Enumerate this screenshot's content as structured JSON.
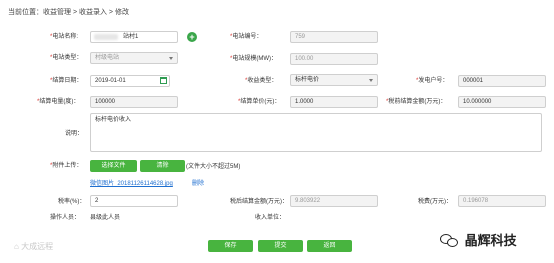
{
  "breadcrumb": "当前位置：收益管理 > 收益录入 > 修改",
  "form": {
    "station_name": {
      "label": "电站名称:",
      "value": "站村1"
    },
    "station_no": {
      "label": "电站编号：",
      "value": "759"
    },
    "station_type": {
      "label": "电站类型：",
      "value": "村级电站"
    },
    "station_scale": {
      "label": "电站规模(MW)：",
      "value": "100.00"
    },
    "settle_date": {
      "label": "结算日期：",
      "value": "2019-01-01"
    },
    "income_type": {
      "label": "收益类型：",
      "value": "标杆电价"
    },
    "account_no": {
      "label": "发电户号：",
      "value": "000001"
    },
    "settle_power": {
      "label": "结算电量(度)：",
      "value": "100000"
    },
    "settle_price": {
      "label": "结算单价(元)：",
      "value": "1.0000"
    },
    "pretax_amount": {
      "label": "税前结算金额(万元)：",
      "value": "10.000000"
    },
    "description": {
      "label": "说明：",
      "value": "标杆电价收入"
    },
    "attachment": {
      "label": "附件上传：",
      "choose_button": "选择文件",
      "clear_button": "清除",
      "hint": "(文件大小不超过5M)",
      "file_name": "微信图片_20181126114628.jpg",
      "delete_link": "删除"
    },
    "tax_rate": {
      "label": "税率(%)：",
      "value": "2"
    },
    "aftertax_amount": {
      "label": "税后结算金额(万元)：",
      "value": "9.803922"
    },
    "tax_amount": {
      "label": "税费(万元)：",
      "value": "0.196078"
    },
    "operator": {
      "label": "操作人员：",
      "value": "县级此人员"
    },
    "receiver": {
      "label": "收入单位：",
      "value": ""
    }
  },
  "actions": {
    "save": "保存",
    "submit": "提交",
    "back": "返回"
  },
  "watermarks": {
    "left": "大成远程",
    "right": "晶辉科技"
  },
  "colors": {
    "accent_green": "#48b43f",
    "required_red": "#d9302a",
    "link_blue": "#1f6fd0"
  }
}
